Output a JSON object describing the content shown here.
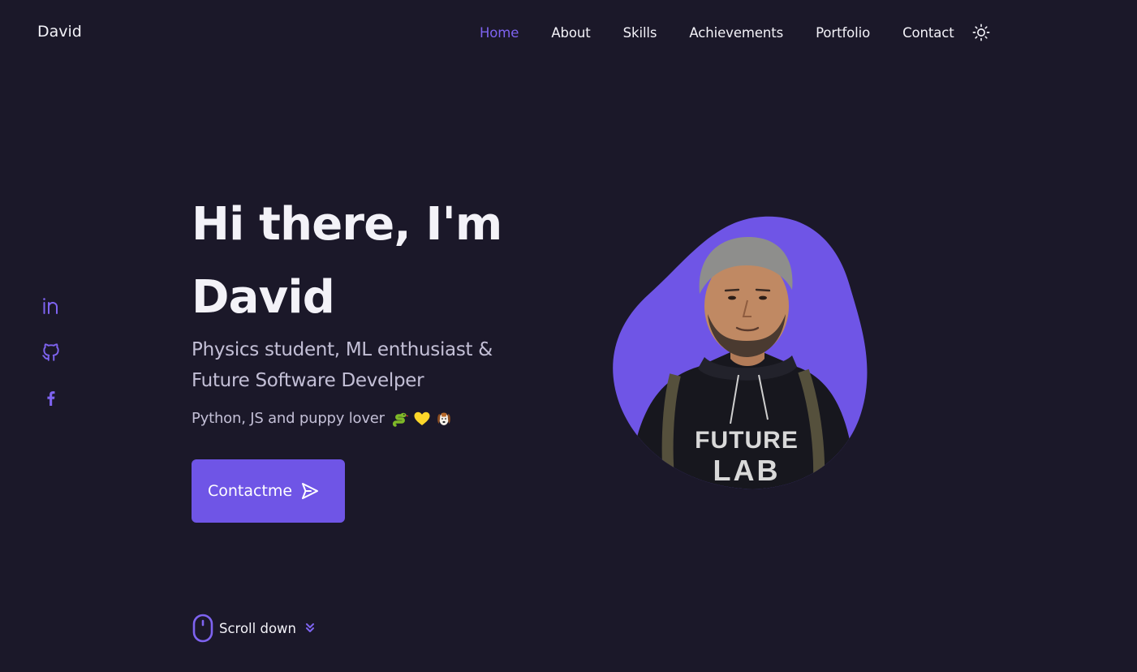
{
  "header": {
    "logo": "David",
    "nav": [
      {
        "label": "Home",
        "active": true
      },
      {
        "label": "About",
        "active": false
      },
      {
        "label": "Skills",
        "active": false
      },
      {
        "label": "Achievements",
        "active": false
      },
      {
        "label": "Portfolio",
        "active": false
      },
      {
        "label": "Contact",
        "active": false
      }
    ],
    "theme_icon": "sun-icon"
  },
  "social": [
    {
      "icon": "linkedin-icon"
    },
    {
      "icon": "github-icon"
    },
    {
      "icon": "facebook-icon"
    }
  ],
  "hero": {
    "title_line1": "Hi there, I'm",
    "title_line2": "David",
    "subtitle_line1": "Physics student, ML enthusiast &",
    "subtitle_line2": "Future Software Develper",
    "description": "Python, JS and puppy lover",
    "emojis": [
      "snake-icon",
      "yellow-heart-icon",
      "dog-icon"
    ],
    "button_label": "Contactme",
    "button_icon": "send-icon",
    "profile_shirt_text": "FUTURE LAB"
  },
  "scroll": {
    "label": "Scroll down",
    "icons": [
      "mouse-icon",
      "double-chevron-down-icon"
    ]
  },
  "colors": {
    "background": "#1b1829",
    "accent": "#6f55e6",
    "text": "#f3f2f8",
    "muted_text": "#c3bfd6"
  }
}
